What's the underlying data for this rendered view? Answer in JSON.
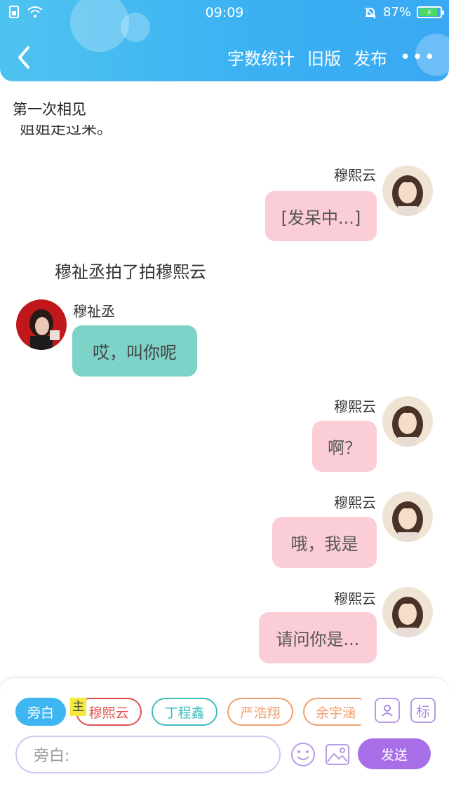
{
  "status_bar": {
    "time": "09:09",
    "battery": "87%",
    "battery_level": 0.87,
    "icons": [
      "sim-icon",
      "wifi-icon",
      "mute-bell-icon",
      "battery-icon"
    ]
  },
  "nav": {
    "back_icon": "chevron-left-icon",
    "word_count": "字数统计",
    "old_version": "旧版",
    "publish": "发布",
    "more": "•••"
  },
  "chapter_title": "第一次相见",
  "clipped_text": "姐姐走过来。",
  "system_message": "穆祉丞拍了拍穆熙云",
  "messages": [
    {
      "side": "right",
      "sender": "穆熙云",
      "text": "[发呆中...]",
      "color": "pink"
    },
    {
      "side": "left",
      "sender": "穆祉丞",
      "text": "哎，叫你呢",
      "color": "teal"
    },
    {
      "side": "right",
      "sender": "穆熙云",
      "text": "啊？",
      "color": "pink"
    },
    {
      "side": "right",
      "sender": "穆熙云",
      "text": "哦，我是",
      "color": "pink"
    },
    {
      "side": "right",
      "sender": "穆熙云",
      "text": "请问你是...",
      "color": "pink"
    }
  ],
  "roles": {
    "narration": "旁白",
    "host_badge": "主",
    "chips": [
      "穆熙云",
      "丁程鑫",
      "严浩翔",
      "余宇涵"
    ],
    "chip_colors": [
      "#e0524f",
      "#3dbfb8",
      "#f0a070",
      "#f0a070"
    ],
    "tag_button": "标"
  },
  "composer": {
    "placeholder": "旁白:",
    "send": "发送",
    "emoji_icon": "smiley-icon",
    "image_icon": "image-icon",
    "role_icon": "person-card-icon"
  },
  "colors": {
    "header": "#3ab0f2",
    "pink_bubble": "#fbcdd6",
    "teal_bubble": "#7ed3c8",
    "send": "#a76ee8"
  }
}
